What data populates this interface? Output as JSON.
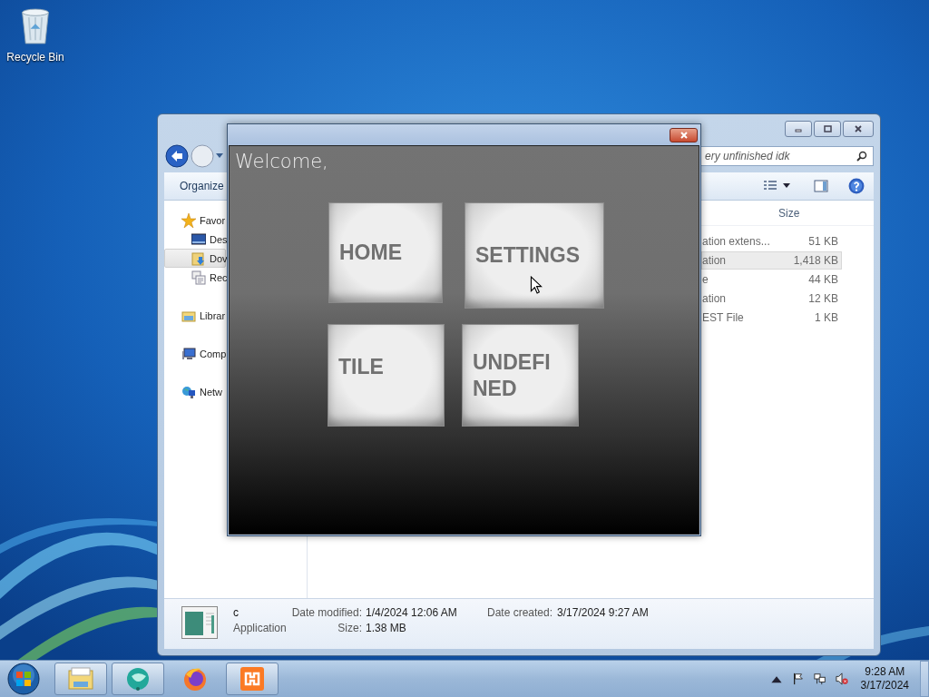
{
  "desktop": {
    "icons": [
      {
        "label": "Recycle Bin"
      }
    ]
  },
  "explorer": {
    "search": {
      "placeholder": "ery unfinished idk"
    },
    "toolbar": {
      "organize": "Organize"
    },
    "nav": [
      {
        "label": "Favor",
        "kind": "star",
        "selected": false,
        "children": [
          {
            "label": "Des",
            "kind": "desktop",
            "selected": false
          },
          {
            "label": "Dov",
            "kind": "download",
            "selected": true
          },
          {
            "label": "Rec",
            "kind": "recent",
            "selected": false
          }
        ]
      },
      {
        "label": "Librar",
        "kind": "library",
        "selected": false
      },
      {
        "label": "Comp",
        "kind": "computer",
        "selected": false
      },
      {
        "label": "Netw",
        "kind": "network",
        "selected": false
      }
    ],
    "columns": [
      "Size"
    ],
    "rows": [
      {
        "type": "ation extens...",
        "size": "51 KB",
        "selected": false
      },
      {
        "type": "ation",
        "size": "1,418 KB",
        "selected": true
      },
      {
        "type": "e",
        "size": "44 KB",
        "selected": false
      },
      {
        "type": "ation",
        "size": "12 KB",
        "selected": false
      },
      {
        "type": "EST File",
        "size": "1 KB",
        "selected": false
      }
    ],
    "details": {
      "name": "c",
      "type": "Application",
      "modified_label": "Date modified:",
      "modified": "1/4/2024 12:06 AM",
      "size_label": "Size:",
      "size": "1.38 MB",
      "created_label": "Date created:",
      "created": "3/17/2024 9:27 AM"
    }
  },
  "app": {
    "greeting": "Welcome,",
    "tiles": [
      {
        "label": "HOME"
      },
      {
        "label": "SETTINGS"
      },
      {
        "label": "TILE"
      },
      {
        "label": "UNDEFINED"
      }
    ]
  },
  "taskbar": {
    "buttons": [
      {
        "kind": "folder",
        "running": true
      },
      {
        "kind": "orb",
        "running": true
      },
      {
        "kind": "fox",
        "running": false
      },
      {
        "kind": "app",
        "running": true
      }
    ],
    "clock": {
      "time": "9:28 AM",
      "date": "3/17/2024"
    }
  }
}
